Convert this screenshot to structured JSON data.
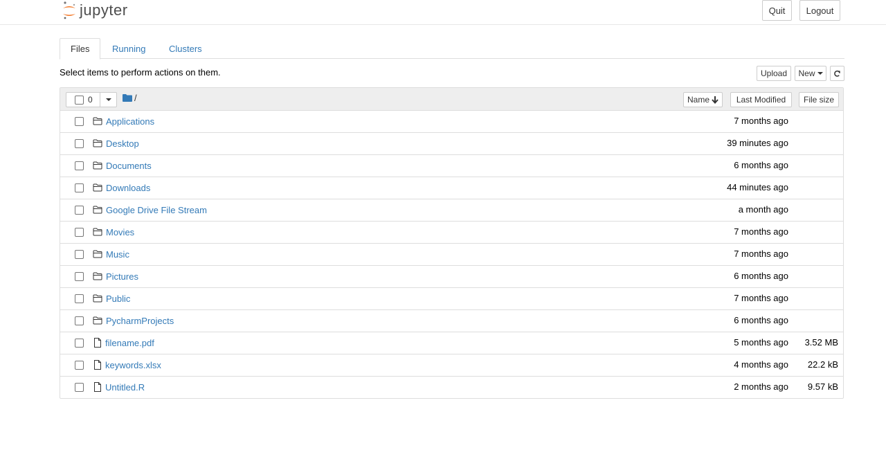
{
  "header": {
    "logo_text": "jupyter",
    "quit_label": "Quit",
    "logout_label": "Logout"
  },
  "tabs": [
    {
      "label": "Files",
      "active": true
    },
    {
      "label": "Running",
      "active": false
    },
    {
      "label": "Clusters",
      "active": false
    }
  ],
  "toolbar": {
    "instructions": "Select items to perform actions on them.",
    "upload_label": "Upload",
    "new_label": "New",
    "refresh_icon": "refresh-icon"
  },
  "list_header": {
    "selected_count": "0",
    "path": "/",
    "sort_name_label": "Name",
    "sort_modified_label": "Last Modified",
    "sort_size_label": "File size"
  },
  "items": [
    {
      "name": "Applications",
      "type": "folder",
      "modified": "7 months ago",
      "size": ""
    },
    {
      "name": "Desktop",
      "type": "folder",
      "modified": "39 minutes ago",
      "size": ""
    },
    {
      "name": "Documents",
      "type": "folder",
      "modified": "6 months ago",
      "size": ""
    },
    {
      "name": "Downloads",
      "type": "folder",
      "modified": "44 minutes ago",
      "size": ""
    },
    {
      "name": "Google Drive File Stream",
      "type": "folder",
      "modified": "a month ago",
      "size": ""
    },
    {
      "name": "Movies",
      "type": "folder",
      "modified": "7 months ago",
      "size": ""
    },
    {
      "name": "Music",
      "type": "folder",
      "modified": "7 months ago",
      "size": ""
    },
    {
      "name": "Pictures",
      "type": "folder",
      "modified": "6 months ago",
      "size": ""
    },
    {
      "name": "Public",
      "type": "folder",
      "modified": "7 months ago",
      "size": ""
    },
    {
      "name": "PycharmProjects",
      "type": "folder",
      "modified": "6 months ago",
      "size": ""
    },
    {
      "name": "filename.pdf",
      "type": "file",
      "modified": "5 months ago",
      "size": "3.52 MB"
    },
    {
      "name": "keywords.xlsx",
      "type": "file",
      "modified": "4 months ago",
      "size": "22.2 kB"
    },
    {
      "name": "Untitled.R",
      "type": "file",
      "modified": "2 months ago",
      "size": "9.57 kB"
    }
  ],
  "colors": {
    "link": "#337ab7",
    "logo_orange": "#f37726",
    "folder_solid": "#337ab7"
  }
}
